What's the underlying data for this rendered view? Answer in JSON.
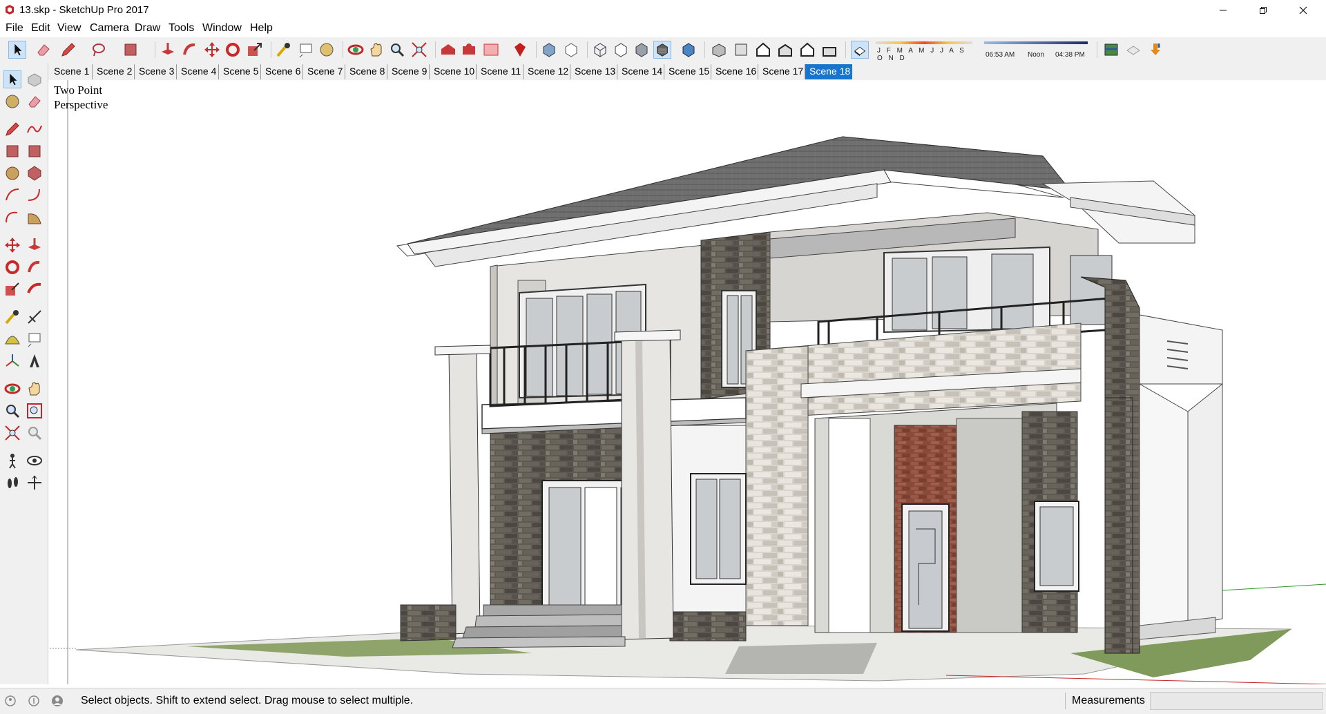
{
  "window": {
    "title": "13.skp - SketchUp Pro 2017",
    "minimize_icon": "minimize-icon",
    "restore_icon": "restore-icon",
    "close_icon": "close-icon",
    "brand_color": "#c8242b"
  },
  "menu": [
    "File",
    "Edit",
    "View",
    "Camera",
    "Draw",
    "Tools",
    "Window",
    "Help"
  ],
  "top_toolbar": {
    "tools": [
      "select-icon",
      "eraser-icon",
      "pencil-icon",
      "lasso-icon",
      "paint-bucket-icon",
      "push-pull-icon",
      "follow-me-icon",
      "move-icon",
      "rotate-icon",
      "scale-icon",
      "tape-measure-icon",
      "text-icon",
      "paint-icon",
      "orbit-icon",
      "pan-icon",
      "zoom-icon",
      "zoom-extents-icon",
      "warehouse-icon",
      "extension-warehouse-icon",
      "layout-icon",
      "ruby-icon",
      "xray-icon",
      "back-edges-icon",
      "wireframe-icon",
      "hidden-line-icon",
      "shaded-icon",
      "shaded-textures-icon",
      "monochrome-icon",
      "iso-view-icon",
      "top-view-icon",
      "front-view-icon",
      "right-view-icon",
      "back-view-icon",
      "left-view-icon",
      "shadows-toggle-icon",
      "styles-icon",
      "geolocation-icon",
      "download-icon"
    ],
    "shadow_months": "J F M A M J J A S O N D",
    "shadow_time_start": "06:53 AM",
    "shadow_time_mid": "Noon",
    "shadow_time_end": "04:38 PM"
  },
  "scenes": {
    "tabs": [
      "Scene 1",
      "Scene 2",
      "Scene 3",
      "Scene 4",
      "Scene 5",
      "Scene 6",
      "Scene 7",
      "Scene 8",
      "Scene 9",
      "Scene 10",
      "Scene 11",
      "Scene 12",
      "Scene 13",
      "Scene 14",
      "Scene 15",
      "Scene 16",
      "Scene 17",
      "Scene 18"
    ],
    "active": "Scene 18",
    "active_color": "#1874cd"
  },
  "left_toolbar": {
    "tools": [
      "select-icon",
      "make-component-icon",
      "paint-bucket-icon",
      "eraser-icon",
      "line-icon",
      "freehand-icon",
      "rectangle-icon",
      "rotated-rectangle-icon",
      "circle-icon",
      "polygon-icon",
      "arc-icon",
      "two-point-arc-icon",
      "three-point-arc-icon",
      "pie-icon",
      "move-icon",
      "push-pull-icon",
      "rotate-icon",
      "follow-me-icon",
      "scale-icon",
      "offset-icon",
      "tape-measure-icon",
      "dimension-icon",
      "protractor-icon",
      "text-icon",
      "axes-icon",
      "3d-text-icon",
      "orbit-icon",
      "pan-icon",
      "zoom-icon",
      "zoom-window-icon",
      "zoom-extents-icon",
      "previous-view-icon",
      "position-camera-icon",
      "look-around-icon",
      "walk-icon",
      "section-plane-icon"
    ]
  },
  "viewport": {
    "camera_label": "Two Point\nPerspective",
    "scene_subject": "two-storey-house-model"
  },
  "status": {
    "icons": [
      "geolocation-status-icon",
      "credits-icon",
      "user-icon"
    ],
    "message": "Select objects. Shift to extend select. Drag mouse to select multiple.",
    "measurements_label": "Measurements",
    "measurements_value": ""
  }
}
